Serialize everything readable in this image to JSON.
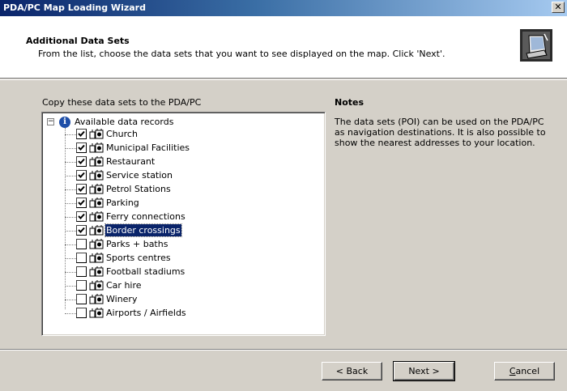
{
  "window": {
    "title": "PDA/PC Map Loading Wizard",
    "close_glyph": "✕"
  },
  "header": {
    "title": "Additional Data Sets",
    "subtitle": "From the list, choose the data sets that you want to see displayed on the map. Click 'Next'.",
    "icon": "pda-device-icon"
  },
  "left_panel": {
    "label": "Copy these data sets to the PDA/PC",
    "root": {
      "label": "Available data records",
      "expander": "−",
      "info_glyph": "i"
    },
    "items": [
      {
        "label": "Church",
        "checked": true
      },
      {
        "label": "Municipal Facilities",
        "checked": true
      },
      {
        "label": "Restaurant",
        "checked": true
      },
      {
        "label": "Service station",
        "checked": true
      },
      {
        "label": "Petrol Stations",
        "checked": true
      },
      {
        "label": "Parking",
        "checked": true
      },
      {
        "label": "Ferry connections",
        "checked": true
      },
      {
        "label": "Border crossings",
        "checked": true,
        "selected": true
      },
      {
        "label": "Parks + baths",
        "checked": false
      },
      {
        "label": "Sports centres",
        "checked": false
      },
      {
        "label": "Football stadiums",
        "checked": false
      },
      {
        "label": "Car hire",
        "checked": false
      },
      {
        "label": "Winery",
        "checked": false
      },
      {
        "label": "Airports / Airfields",
        "checked": false
      }
    ]
  },
  "notes": {
    "title": "Notes",
    "text": "The data sets (POI) can be used on the PDA/PC as navigation destinations. It is also possible to show the nearest addresses to your location."
  },
  "buttons": {
    "back": "< Back",
    "next": "Next >",
    "cancel_first": "C",
    "cancel_rest": "ancel"
  },
  "colors": {
    "titlebar_start": "#0a246a",
    "titlebar_end": "#a6caf0",
    "selection": "#0a246a",
    "dialog_bg": "#d4d0c8"
  }
}
